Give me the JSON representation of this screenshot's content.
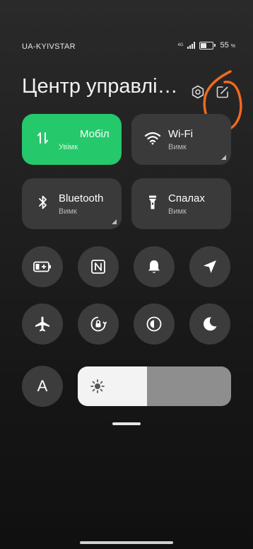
{
  "status_bar": {
    "carrier": "UA-KYIVSTAR",
    "network_type": "4G",
    "battery_percent": "55",
    "battery_symbol": "%",
    "battery_level": 0.55
  },
  "header": {
    "title": "Центр управлін…",
    "settings_icon": "settings-gear-icon",
    "edit_icon": "edit-icon"
  },
  "tiles": [
    {
      "name": "Мобіл",
      "state": "Увімк",
      "icon": "mobile-data-icon",
      "active": true
    },
    {
      "name": "Wi-Fi",
      "state": "Вимк",
      "icon": "wifi-icon",
      "active": false
    },
    {
      "name": "Bluetooth",
      "state": "Вимк",
      "icon": "bluetooth-icon",
      "active": false
    },
    {
      "name": "Спалах",
      "state": "Вимк",
      "icon": "flashlight-icon",
      "active": false
    }
  ],
  "round_buttons": [
    "battery-saver-icon",
    "nfc-icon",
    "bell-icon",
    "location-icon",
    "airplane-mode-icon",
    "rotation-lock-icon",
    "dark-mode-icon",
    "do-not-disturb-icon"
  ],
  "font_button_label": "A",
  "brightness": {
    "level": 0.45,
    "icon": "brightness-sun-icon"
  },
  "colors": {
    "active_tile": "#25c86b",
    "tile": "#3a3a3a",
    "round_button": "#3c3c3c",
    "annotation": "#f06a1e"
  }
}
